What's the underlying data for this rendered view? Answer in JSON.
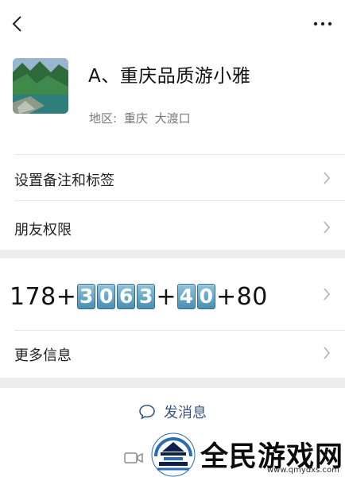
{
  "header": {
    "back_icon": "chevron-left-icon",
    "more_icon": "more-dots-icon"
  },
  "profile": {
    "avatar_icon": "landscape-avatar",
    "name": "A、重庆品质游小雅",
    "region_label": "地区:",
    "region_city": "重庆",
    "region_place": "大渡口"
  },
  "menu": {
    "remark_label": "设置备注和标签",
    "permission_label": "朋友权限",
    "more_info_label": "更多信息"
  },
  "phone": {
    "prefix": "178+",
    "group1": [
      "3",
      "0",
      "6",
      "3"
    ],
    "mid": "+",
    "group2": [
      "4",
      "0"
    ],
    "suffix": "+80"
  },
  "actions": {
    "message_label": "发消息",
    "message_icon": "chat-bubble-icon",
    "video_icon": "video-call-icon"
  },
  "watermark": {
    "text": "全民游戏网",
    "url": "www.qmydxs.com"
  },
  "colors": {
    "link": "#3a5580",
    "key_top": "#8fc3dc",
    "key_bottom": "#4a8fb3",
    "bg": "#ededed"
  }
}
